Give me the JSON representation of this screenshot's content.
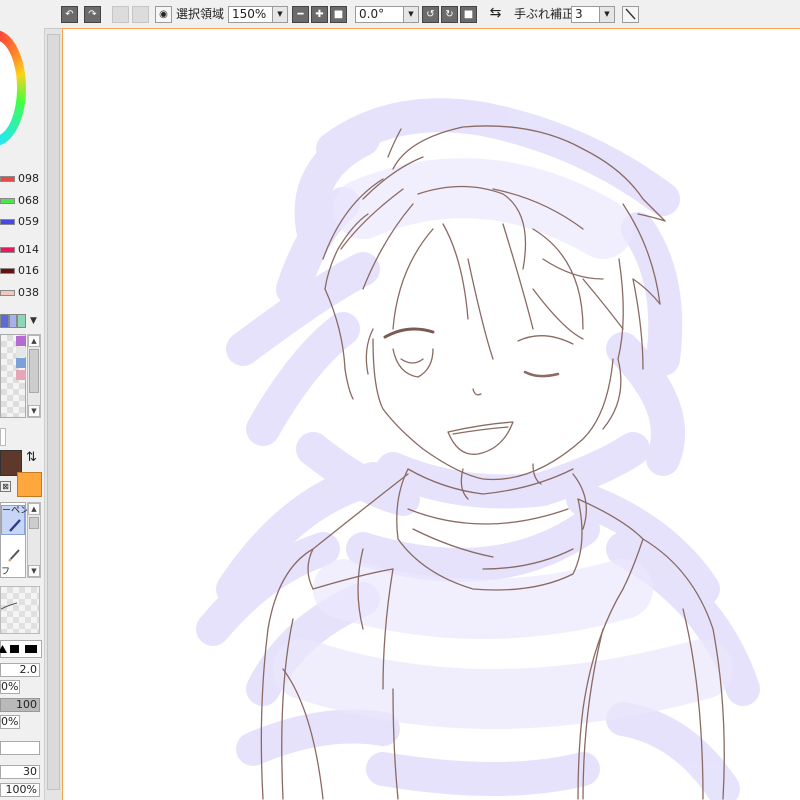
{
  "toolbar": {
    "selection_label": "選択領域",
    "zoom_value": "150%",
    "rotation_value": "0.0°",
    "stabilizer_label": "手ぶれ補正",
    "stabilizer_value": "3"
  },
  "color_sliders": [
    {
      "value": "098",
      "color": "#e84848"
    },
    {
      "value": "068",
      "color": "#48e848"
    },
    {
      "value": "059",
      "color": "#4848e8"
    },
    {
      "value": "014",
      "color": "#e8185a"
    },
    {
      "value": "016",
      "color": "#6a0f12"
    },
    {
      "value": "038",
      "color": "#f1c8bd"
    }
  ],
  "palette_strip": [
    "#5a6ad8",
    "#a9b0ee",
    "#8fd6b8"
  ],
  "swatches": [
    "#b56ad6",
    "#e6e6e6",
    "#7aa2d8",
    "#e6a6b8"
  ],
  "colors": {
    "main": "#5e382a",
    "sub": "#ffa73c",
    "accent_border": "#f2a24e"
  },
  "tools": {
    "pen_label": "ーペン",
    "second_label": "フ"
  },
  "brush": {
    "size": "2.0",
    "min_size": "0%",
    "density": "100",
    "min_density": "0%",
    "blend": "30",
    "blend_pct": "100%"
  },
  "icons": {
    "undo": "undo-icon",
    "redo": "redo-icon",
    "eye": "eye-icon",
    "zoom_out": "minus-icon",
    "zoom_in": "plus-icon",
    "reset": "reset-icon",
    "rotate_ccw": "rotate-ccw-icon",
    "rotate_cw": "rotate-cw-icon",
    "flip": "flip-horizontal-icon",
    "line": "straight-line-icon"
  }
}
